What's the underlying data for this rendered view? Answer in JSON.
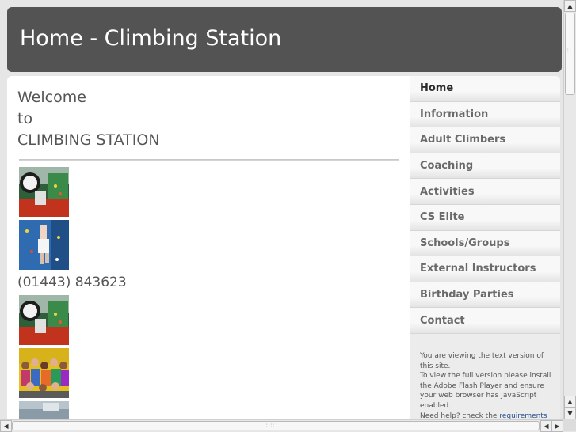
{
  "header": {
    "title": "Home - Climbing Station"
  },
  "welcome": {
    "line1": "Welcome",
    "line2": "to",
    "line3": "CLIMBING STATION"
  },
  "phone": "(01443) 843623",
  "images": [
    {
      "name": "climbing-wall-photo-1",
      "description_icon": "photo"
    },
    {
      "name": "climber-on-wall-photo",
      "description_icon": "photo"
    },
    {
      "name": "climbing-wall-photo-2",
      "description_icon": "photo"
    },
    {
      "name": "group-photo",
      "description_icon": "photo"
    },
    {
      "name": "partial-photo",
      "description_icon": "photo"
    }
  ],
  "nav": {
    "items": [
      {
        "label": "Home",
        "active": true
      },
      {
        "label": "Information",
        "active": false
      },
      {
        "label": "Adult Climbers",
        "active": false
      },
      {
        "label": "Coaching",
        "active": false
      },
      {
        "label": "Activities",
        "active": false
      },
      {
        "label": "CS Elite",
        "active": false
      },
      {
        "label": "Schools/Groups",
        "active": false
      },
      {
        "label": "External Instructors",
        "active": false
      },
      {
        "label": "Birthday Parties",
        "active": false
      },
      {
        "label": "Contact",
        "active": false
      }
    ]
  },
  "text_version": {
    "line1": "You are viewing the text version of this site.",
    "line2": "To view the full version please install the Adobe Flash Player and ensure your web browser has JavaScript enabled.",
    "line3_prefix": "Need help? check the ",
    "line3_link": "requirements"
  },
  "colors": {
    "header_bg": "#535353",
    "header_text": "#ffffff",
    "page_bg": "#e6e6e6",
    "link": "#2a4f8a"
  }
}
